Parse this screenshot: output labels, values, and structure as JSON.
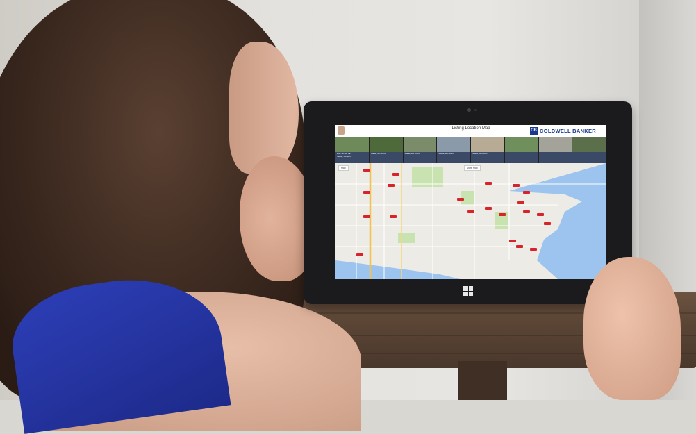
{
  "scene": {
    "description_colors": {
      "dress": "#2437a8",
      "tablet": "#1b1b1d",
      "desk": "#5b4535"
    }
  },
  "app": {
    "title": "Listing Location Map",
    "subtitle": "",
    "user": {
      "name": "",
      "role": ""
    },
    "brand": {
      "name": "COLDWELL BANKER",
      "logo_text": "CB",
      "color": "#1b3a8c"
    }
  },
  "listings": [
    {
      "line1": "",
      "line2": "2237 4th Ave NE",
      "line3": "Seattle, WA 98115",
      "photo": "#6e8a5a"
    },
    {
      "line1": "",
      "line2": "",
      "line3": "Seattle, WA 98105",
      "photo": "#4f6a3a"
    },
    {
      "line1": "",
      "line2": "",
      "line3": "Seattle, WA 98105",
      "photo": "#7a8c6a"
    },
    {
      "line1": "",
      "line2": "",
      "line3": "Seattle, WA 98103",
      "photo": "#8a9aa8"
    },
    {
      "line1": "",
      "line2": "",
      "line3": "Seattle, WA 98103",
      "photo": "#b7ab96"
    },
    {
      "line1": "",
      "line2": "",
      "line3": "",
      "photo": "#6f8f5c"
    },
    {
      "line1": "",
      "line2": "",
      "line3": "",
      "photo": "#a3a39a"
    },
    {
      "line1": "",
      "line2": "",
      "line3": "",
      "photo": "#5b6f4a"
    }
  ],
  "map": {
    "controls": {
      "left": "Map",
      "center": "More Map"
    },
    "pins": [
      "",
      "",
      "",
      "",
      "",
      "",
      "",
      "",
      "",
      "",
      "",
      "",
      "",
      "",
      "",
      "",
      "",
      "",
      "",
      "",
      ""
    ]
  },
  "icons": [
    "windows-logo-icon",
    "camera-icon",
    "coldwell-banker-logo-icon"
  ]
}
